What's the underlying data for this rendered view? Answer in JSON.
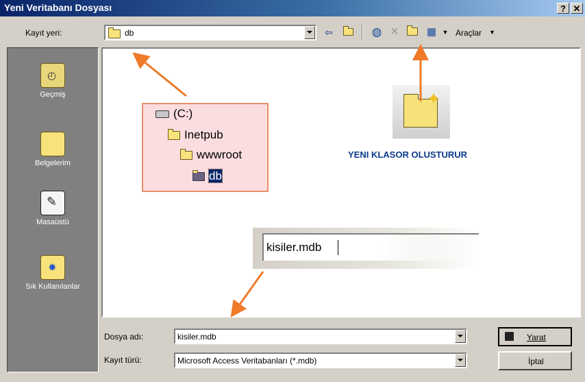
{
  "window": {
    "title": "Yeni Veritabanı Dosyası",
    "help_button": "?",
    "close_button": "✕"
  },
  "toolbar": {
    "location_label": "Kayıt yeri:",
    "location_value": "db",
    "tools_label": "Araçlar"
  },
  "places": [
    {
      "label": "Geçmiş",
      "icon": "history-icon"
    },
    {
      "label": "Belgelerim",
      "icon": "my-documents-icon"
    },
    {
      "label": "Masaüstü",
      "icon": "desktop-icon"
    },
    {
      "label": "Sık Kullanılanlar",
      "icon": "favorites-icon"
    }
  ],
  "tree_callout": {
    "items": [
      "(C:)",
      "Inetpub",
      "wwwroot",
      "db"
    ]
  },
  "new_folder_callout": {
    "caption": "YENI KLASOR OLUSTURUR"
  },
  "filename_callout": {
    "value": "kisiler.mdb"
  },
  "form": {
    "filename_label": "Dosya adı:",
    "filename_value": "kisiler.mdb",
    "filetype_label": "Kayıt türü:",
    "filetype_value": "Microsoft Access Veritabanları (*.mdb)",
    "create_button": "Yarat",
    "cancel_button": "İptal"
  },
  "colors": {
    "title_bar": "#0a246a",
    "annotation_arrow": "#ee7a2a",
    "tree_callout_bg": "#fbdde0",
    "caption_text": "#0b3a8a"
  }
}
